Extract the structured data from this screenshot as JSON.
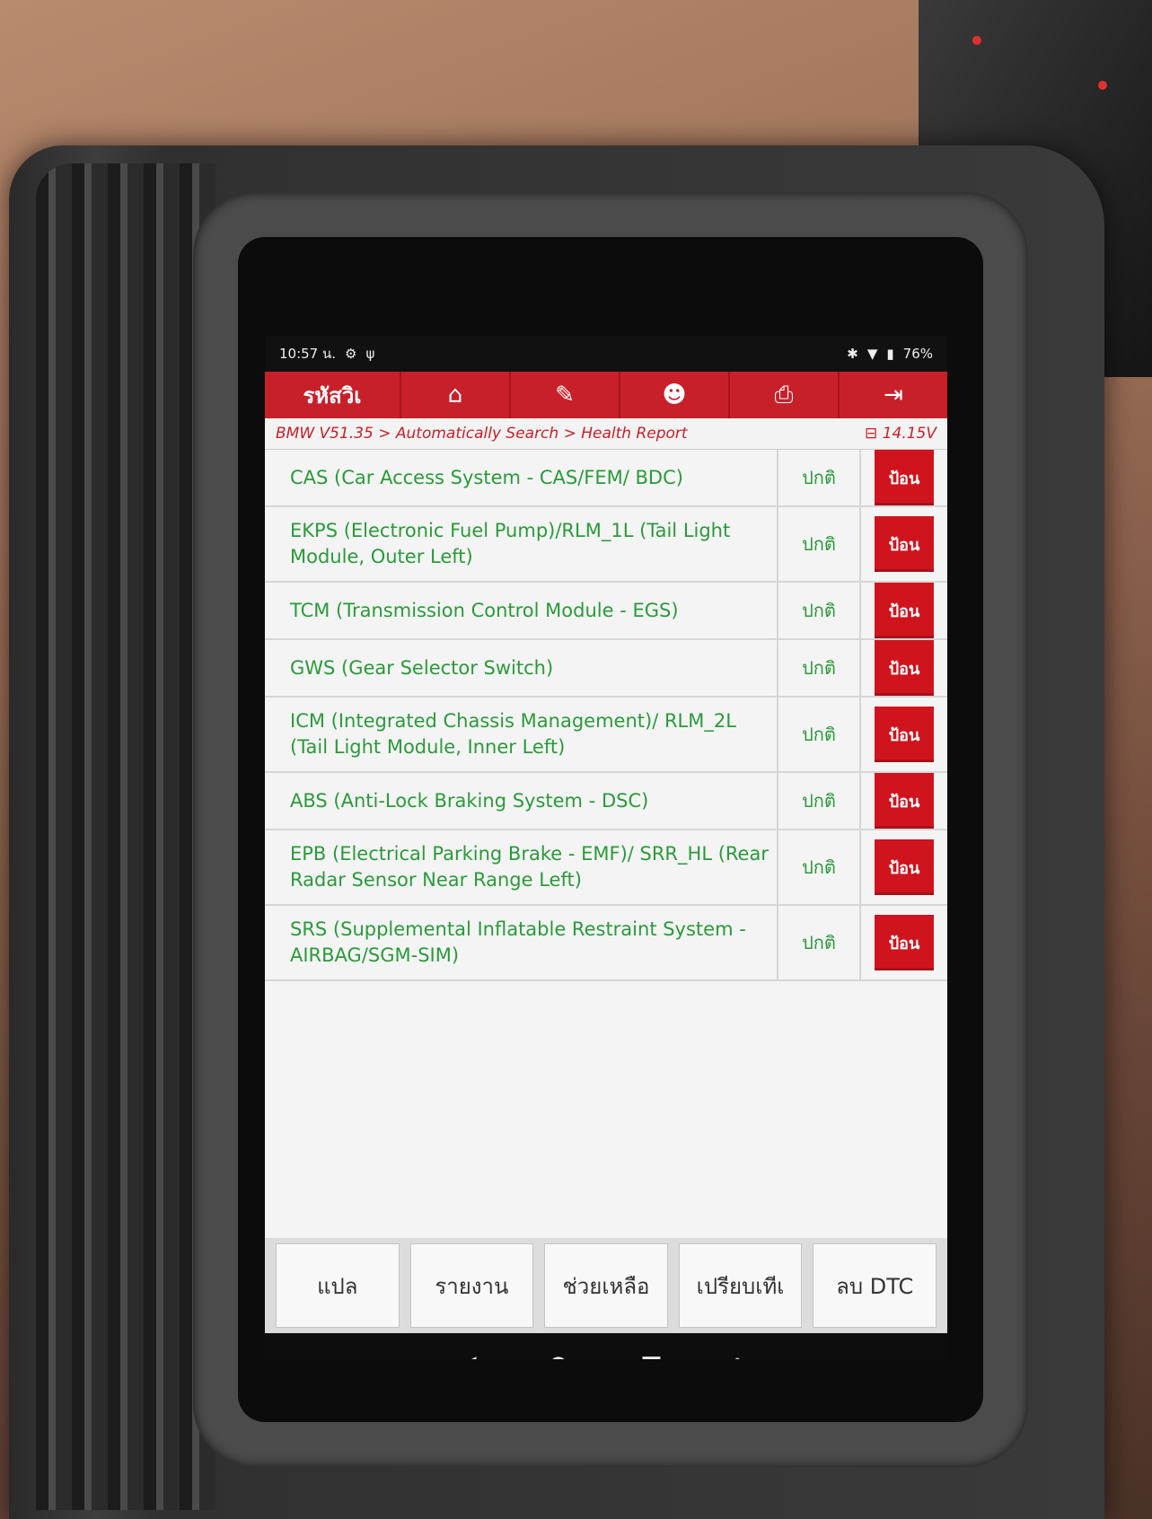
{
  "statusbar": {
    "time": "10:57 น.",
    "battery": "76%"
  },
  "navbar": {
    "title": "รหัสวิเ",
    "icons": [
      "home-icon",
      "edit-report-icon",
      "user-icon",
      "print-icon",
      "exit-icon"
    ]
  },
  "breadcrumb": {
    "path": "BMW V51.35 > Automatically Search > Health Report",
    "voltage": "14.15V"
  },
  "rows": [
    {
      "name": "CAS (Car Access System - CAS/FEM/ BDC)",
      "status": "ปกติ",
      "action": "ป้อน"
    },
    {
      "name": "EKPS (Electronic Fuel Pump)/RLM_1L (Tail Light Module, Outer Left)",
      "status": "ปกติ",
      "action": "ป้อน"
    },
    {
      "name": "TCM (Transmission Control Module - EGS)",
      "status": "ปกติ",
      "action": "ป้อน"
    },
    {
      "name": "GWS (Gear Selector Switch)",
      "status": "ปกติ",
      "action": "ป้อน"
    },
    {
      "name": "ICM (Integrated Chassis Management)/ RLM_2L (Tail Light Module, Inner Left)",
      "status": "ปกติ",
      "action": "ป้อน"
    },
    {
      "name": "ABS (Anti-Lock Braking System - DSC)",
      "status": "ปกติ",
      "action": "ป้อน"
    },
    {
      "name": "EPB (Electrical Parking Brake - EMF)/ SRR_HL (Rear Radar Sensor Near Range Left)",
      "status": "ปกติ",
      "action": "ป้อน"
    },
    {
      "name": "SRS (Supplemental Inflatable Restraint System - AIRBAG/SGM-SIM)",
      "status": "ปกติ",
      "action": "ป้อน"
    }
  ],
  "bottombar": {
    "translate": "แปล",
    "report": "รายงาน",
    "help": "ช่วยเหลือ",
    "compare": "เปรียบเทีเ",
    "clear_dtc": "ลบ DTC"
  },
  "colors": {
    "accent": "#c8202a",
    "ok_text": "#2a9a3a"
  }
}
